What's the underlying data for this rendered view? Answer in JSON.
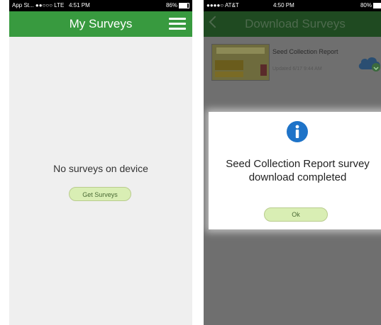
{
  "left_screen": {
    "status": {
      "carrier": "App St... ●●○○○ LTE",
      "time": "4:51 PM",
      "battery": "86%",
      "battery_level": 0.86
    },
    "nav": {
      "title": "My Surveys",
      "menu_icon": "hamburger-menu-icon"
    },
    "empty_message": "No surveys on device",
    "get_surveys_label": "Get Surveys"
  },
  "right_screen": {
    "status": {
      "carrier": "●●●●○ AT&T",
      "time": "4:50 PM",
      "battery": "80%",
      "battery_level": 0.8
    },
    "nav": {
      "title": "Download Surveys",
      "back_icon": "chevron-left-icon"
    },
    "survey": {
      "name": "Seed Collection Report",
      "meta": "Updated 6/17 9:44 AM",
      "download_icon": "cloud-download-icon"
    },
    "dialog": {
      "icon": "info-icon",
      "message": "Seed Collection Report survey download completed",
      "ok_label": "Ok"
    }
  },
  "colors": {
    "header_green": "#389a3f",
    "button_fill": "#d9eeb4",
    "info_blue": "#1e73c8",
    "cloud_blue": "#2a6fb5"
  }
}
